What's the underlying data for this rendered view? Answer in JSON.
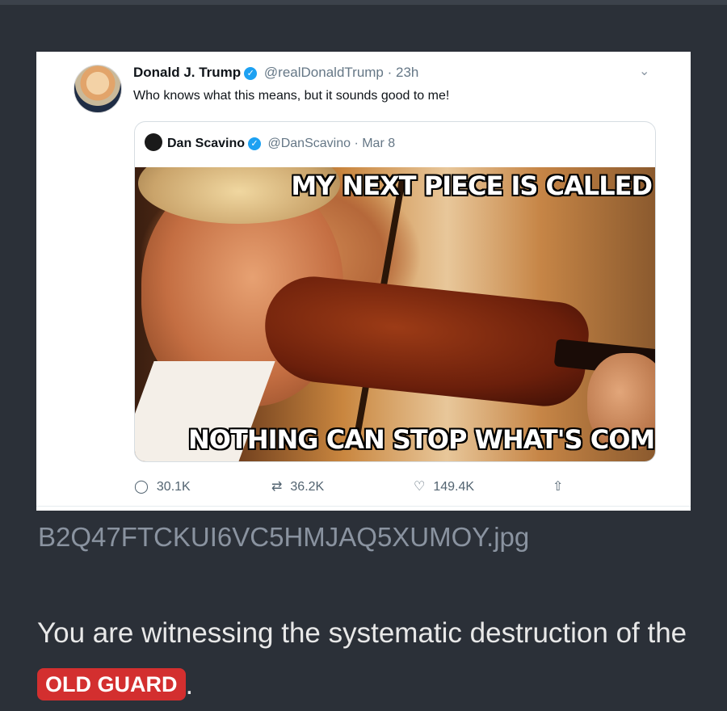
{
  "tweet": {
    "author_name": "Donald J. Trump",
    "author_handle": "@realDonaldTrump",
    "time": "· 23h",
    "text": "Who knows what this means, but it sounds good to me!",
    "verified_icon": "✓",
    "menu_icon": "⌄"
  },
  "quoted": {
    "author_name": "Dan Scavino",
    "author_handle": "@DanScavino",
    "time": "· Mar 8",
    "meme_top": "MY NEXT PIECE IS CALLED",
    "meme_bottom": "NOTHING CAN STOP WHAT'S COMING"
  },
  "actions": {
    "reply_icon": "◯",
    "reply_count": "30.1K",
    "retweet_icon": "⇄",
    "retweet_count": "36.2K",
    "like_icon": "♡",
    "like_count": "149.4K",
    "share_icon": "⇧"
  },
  "post": {
    "filename": "B2Q47FTCKUI6VC5HMJAQ5XUMOY.jpg",
    "caption_before": "You are witnessing the systematic destruction of the ",
    "badge": "OLD GUARD",
    "caption_after": "."
  },
  "colors": {
    "background": "#2b3038",
    "badge": "#d32f2f",
    "verified": "#1da1f2"
  }
}
